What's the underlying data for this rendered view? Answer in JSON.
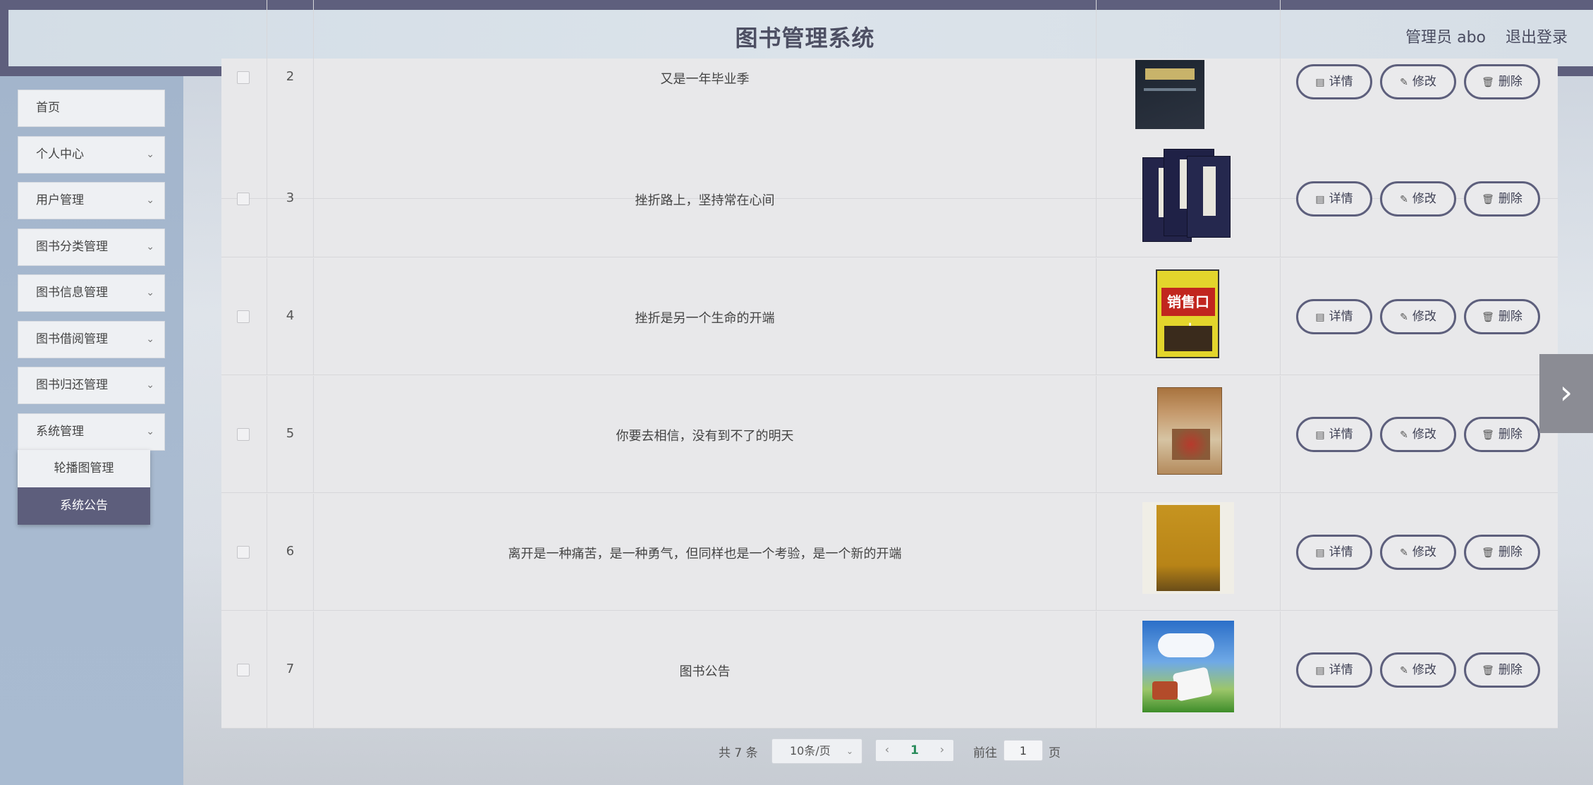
{
  "header": {
    "title": "图书管理系统",
    "user": "管理员 abo",
    "logout": "退出登录"
  },
  "sidebar": {
    "items": [
      {
        "label": "首页",
        "has_arrow": false
      },
      {
        "label": "个人中心",
        "has_arrow": true
      },
      {
        "label": "用户管理",
        "has_arrow": true
      },
      {
        "label": "图书分类管理",
        "has_arrow": true
      },
      {
        "label": "图书信息管理",
        "has_arrow": true
      },
      {
        "label": "图书借阅管理",
        "has_arrow": true
      },
      {
        "label": "图书归还管理",
        "has_arrow": true
      },
      {
        "label": "系统管理",
        "has_arrow": true
      }
    ],
    "submenu": [
      {
        "label": "轮播图管理",
        "active": false
      },
      {
        "label": "系统公告",
        "active": true
      }
    ]
  },
  "table": {
    "rows": [
      {
        "index": "2",
        "title": "又是一年毕业季"
      },
      {
        "index": "3",
        "title": "挫折路上，坚持常在心间"
      },
      {
        "index": "4",
        "title": "挫折是另一个生命的开端"
      },
      {
        "index": "5",
        "title": "你要去相信，没有到不了的明天"
      },
      {
        "index": "6",
        "title": "离开是一种痛苦，是一种勇气，但同样也是一个考验，是一个新的开端"
      },
      {
        "index": "7",
        "title": "图书公告"
      }
    ],
    "actions": {
      "detail": "详情",
      "edit": "修改",
      "delete": "删除"
    },
    "cover_text": {
      "cover4": "销售口才"
    }
  },
  "pagination": {
    "total": "共 7 条",
    "page_size": "10条/页",
    "current_page": "1",
    "goto_label": "前往",
    "goto_value": "1",
    "unit": "页"
  },
  "icons": {
    "detail": "document-icon",
    "edit": "pencil-icon",
    "delete": "trash-icon",
    "chevron": "chevron-down-icon",
    "next": "chevron-right-icon"
  },
  "colors": {
    "accent": "#5d5e7c",
    "page_current": "#2a8c5c"
  }
}
